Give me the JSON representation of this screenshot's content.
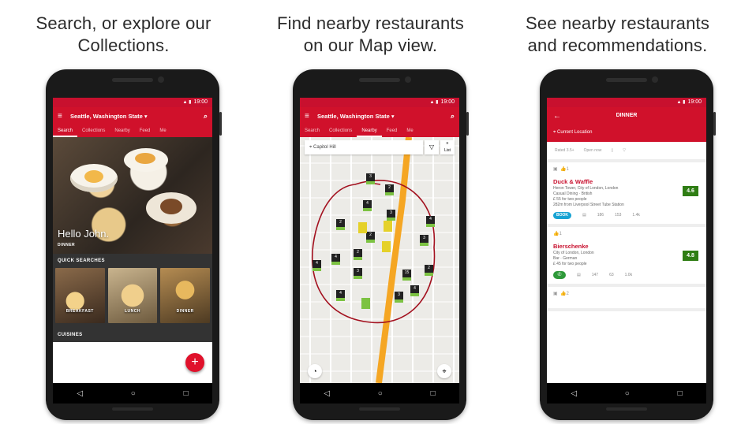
{
  "panels": [
    {
      "caption": "Search, or explore our\nCollections."
    },
    {
      "caption": "Find nearby restaurants\non our Map view."
    },
    {
      "caption": "See nearby restaurants\nand recommendations."
    }
  ],
  "status_time": "19:00",
  "app_bar": {
    "location": "Seattle, Washington State ▾"
  },
  "tabs": [
    "Search",
    "Collections",
    "Nearby",
    "Feed",
    "Me"
  ],
  "screen1": {
    "greeting": "Hello John.",
    "meal": "DINNER",
    "quick_searches_title": "QUICK SEARCHES",
    "quick_cards": [
      "BREAKFAST",
      "LUNCH",
      "DINNER"
    ],
    "cuisines_title": "CUISINES",
    "fab": "+"
  },
  "screen2": {
    "search_value": "Capitol Hill",
    "filter_icon": "filter-icon",
    "list_label": "List",
    "pins": [
      "3",
      "2",
      "4",
      "2",
      "3",
      "4",
      "2",
      "3",
      "4",
      "4",
      "3",
      "15",
      "2",
      "4",
      "4",
      "3",
      "2"
    ]
  },
  "screen3": {
    "title": "DINNER",
    "current_location": "Current Location",
    "filters": [
      "Rated 3.5+",
      "Open now"
    ],
    "restaurants": [
      {
        "likes": "1",
        "name": "Duck & Waffle",
        "address": "Heron Tower, City of London, London",
        "type": "Casual Dining · British",
        "cost": "£ 55 for two people",
        "distance": "282m from Liverpool Street Tube Station",
        "rating": "4.6",
        "action": "BOOK",
        "stats": [
          "186",
          "153",
          "1.4k"
        ]
      },
      {
        "likes": "1",
        "name": "Bierschenke",
        "address": "City of London, London",
        "type": "Bar · German",
        "cost": "£ 45 for two people",
        "rating": "4.8",
        "stats": [
          "147",
          "63",
          "1.0k"
        ]
      }
    ],
    "third_card_likes": "2"
  },
  "nav": {
    "back": "◁",
    "home": "○",
    "recents": "□"
  },
  "colors": {
    "brand_red": "#d0112b",
    "rating_green": "#2f7d14",
    "pin_green": "#7cc242"
  }
}
